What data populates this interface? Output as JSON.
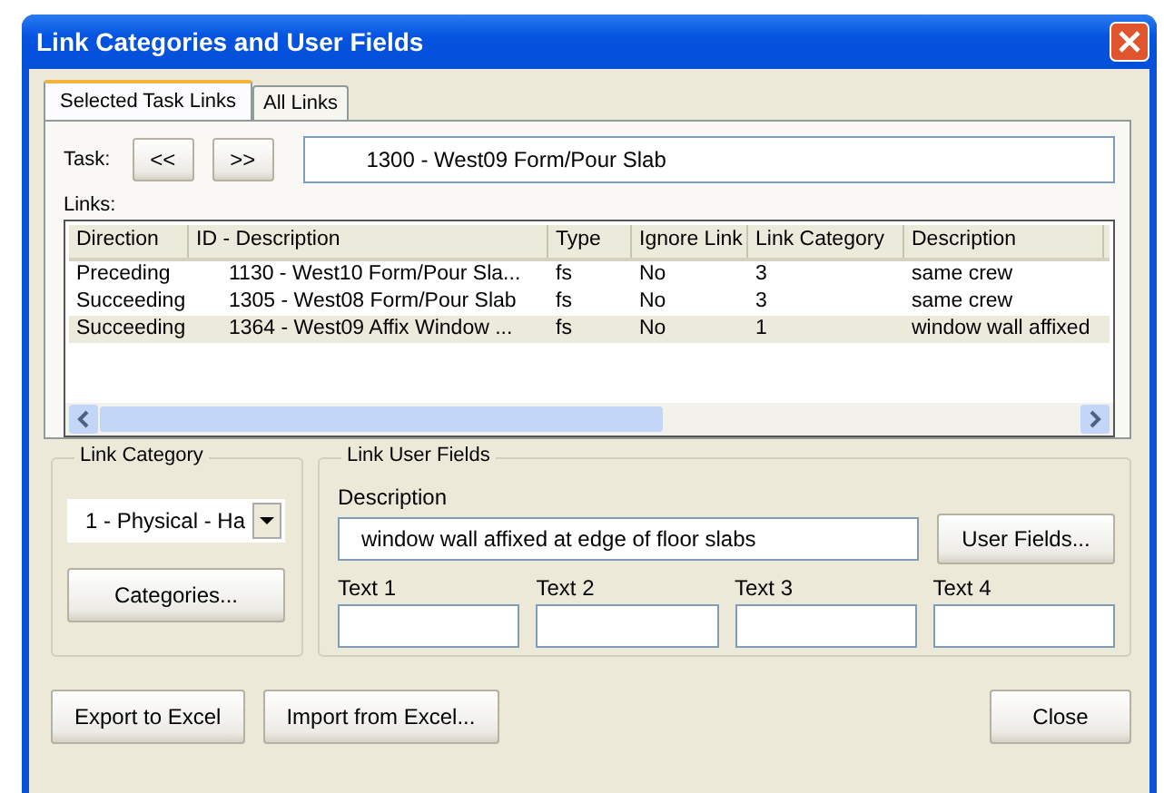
{
  "window": {
    "title": "Link Categories and User Fields"
  },
  "tabs": [
    {
      "label": "Selected Task Links",
      "selected": true
    },
    {
      "label": "All Links",
      "selected": false
    }
  ],
  "task": {
    "label": "Task:",
    "prev": "<<",
    "next": ">>",
    "value": "1300 - West09 Form/Pour Slab"
  },
  "links": {
    "label": "Links:",
    "columns": [
      "Direction",
      "ID - Description",
      "Type",
      "Ignore Link",
      "Link Category",
      "Description"
    ],
    "rows": [
      {
        "cells": [
          "Preceding",
          "1130 - West10 Form/Pour Sla...",
          "fs",
          "No",
          "3",
          "same crew"
        ],
        "selected": false
      },
      {
        "cells": [
          "Succeeding",
          "1305 - West08 Form/Pour Slab",
          "fs",
          "No",
          "3",
          "same crew"
        ],
        "selected": false
      },
      {
        "cells": [
          "Succeeding",
          "1364 - West09 Affix Window ...",
          "fs",
          "No",
          "1",
          "window wall affixed"
        ],
        "selected": true
      }
    ]
  },
  "link_category": {
    "title": "Link Category",
    "value": "1 - Physical - Ha",
    "button": "Categories..."
  },
  "link_user_fields": {
    "title": "Link User Fields",
    "description_label": "Description",
    "description": "window wall affixed at edge of floor slabs",
    "button": "User Fields...",
    "texts": [
      {
        "label": "Text 1"
      },
      {
        "label": "Text 2"
      },
      {
        "label": "Text 3"
      },
      {
        "label": "Text 4"
      }
    ]
  },
  "buttons": {
    "export": "Export to Excel",
    "import": "Import from Excel...",
    "close": "Close"
  }
}
